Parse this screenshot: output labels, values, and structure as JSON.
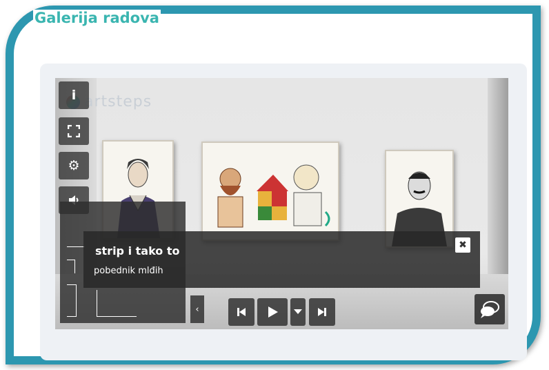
{
  "page": {
    "heading": "Galerija radova"
  },
  "viewer": {
    "watermark": "artsteps",
    "caption": {
      "title": "strip i tako to",
      "subtitle": "pobednik mlđih"
    },
    "toolbar": {
      "info_icon": "info-icon",
      "fullscreen_icon": "fullscreen-icon",
      "settings_icon": "gear-icon",
      "sound_icon": "speaker-icon"
    },
    "playback": {
      "prev_icon": "skip-back-icon",
      "play_icon": "play-icon",
      "dropdown_icon": "chevron-down-icon",
      "next_icon": "skip-forward-icon",
      "collapse_icon": "chevron-left-icon"
    },
    "chat_icon": "chat-bubbles-icon",
    "close_icon": "close-icon"
  },
  "colors": {
    "frame": "#2d97b0",
    "heading": "#3ab5b0",
    "panel": "#eef1f5"
  }
}
